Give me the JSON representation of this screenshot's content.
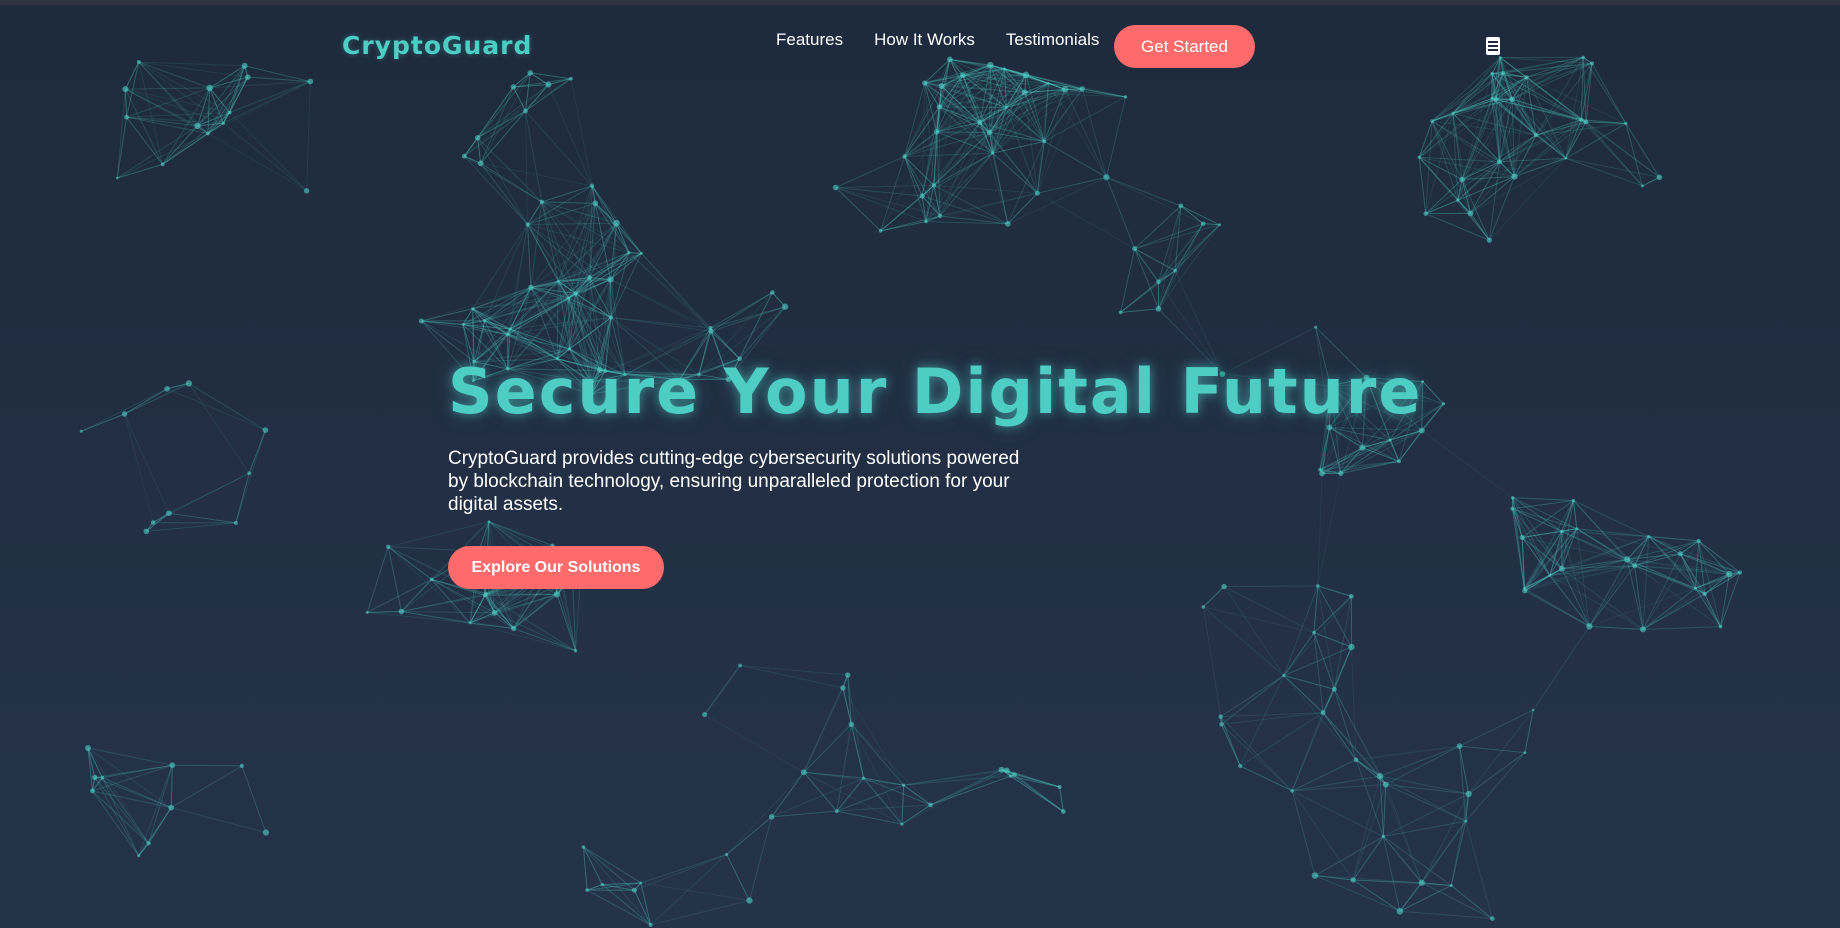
{
  "brand": {
    "name": "CryptoGuard"
  },
  "nav": {
    "items": [
      {
        "label": "Features"
      },
      {
        "label": "How It Works"
      },
      {
        "label": "Testimonials"
      }
    ],
    "cta_label": "Get Started",
    "menu_icon": "hamburger-menu-icon"
  },
  "hero": {
    "title": "Secure Your Digital Future",
    "subtitle": "CryptoGuard provides cutting-edge cybersecurity solutions powered by blockchain technology, ensuring unparalleled protection for your digital assets.",
    "cta_label": "Explore Our Solutions"
  },
  "colors": {
    "background": "#1e2a3d",
    "accent": "#4ecdc4",
    "button": "#ff6b6b",
    "text": "#ffffff"
  },
  "background_graphic": "network-particles"
}
